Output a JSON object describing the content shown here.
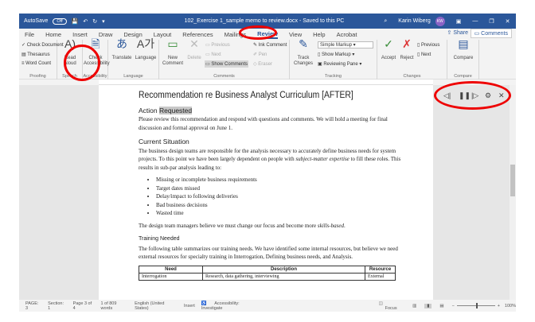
{
  "title": {
    "autosave": "AutoSave",
    "autosave_state": "Off",
    "doc": "102_Exercise 1_sample memo to review.docx  -  Saved to this PC",
    "user": "Karin Wiberg",
    "initials": "KW"
  },
  "tabs": [
    "File",
    "Home",
    "Insert",
    "Draw",
    "Design",
    "Layout",
    "References",
    "Mailings",
    "Review",
    "View",
    "Help",
    "Acrobat"
  ],
  "share": "Share",
  "comments_btn": "Comments",
  "ribbon": {
    "proofing": {
      "label": "Proofing",
      "items": [
        "Check Document",
        "Thesaurus",
        "Word Count"
      ]
    },
    "speech": {
      "label": "Speech",
      "read": "Read",
      "aloud": "Aloud"
    },
    "accessibility": {
      "label": "Accessibility",
      "l1": "Check",
      "l2": "Accessibility"
    },
    "language": {
      "label": "Language",
      "translate": "Translate",
      "language": "Language"
    },
    "comments": {
      "label": "Comments",
      "new1": "New",
      "new2": "Comment",
      "delete": "Delete",
      "previous": "Previous",
      "next": "Next",
      "show": "Show Comments"
    },
    "ink": {
      "ink": "Ink Comment",
      "pen": "Pen",
      "eraser": "Eraser"
    },
    "tracking": {
      "label": "Tracking",
      "track1": "Track",
      "track2": "Changes",
      "markup": "Simple Markup",
      "show_markup": "Show Markup",
      "pane": "Reviewing Pane"
    },
    "changes": {
      "label": "Changes",
      "accept": "Accept",
      "reject": "Reject",
      "previous": "Previous",
      "next": "Next"
    },
    "compare": {
      "label": "Compare",
      "compare": "Compare"
    }
  },
  "doc": {
    "title": "Recommendation re Business Analyst Curriculum [AFTER]",
    "h_action_1": "Action ",
    "h_action_2": "Requested",
    "p1": "Please review this recommendation and respond with questions and comments. We will hold a meeting for final discussion and formal approval on June 1.",
    "h_current": "Current Situation",
    "p2a": "The business design teams are responsible for the analysis necessary to accurately define business needs for system projects. To this point we have been largely dependent on people with ",
    "p2b": "subject-matter expertise",
    "p2c": " to fill these roles. This results in sub-par analysis leading to:",
    "bullets": [
      "Missing or incomplete business requirements",
      "Target dates missed",
      "Delay/impact to following deliveries",
      "Bad business decisions",
      "Wasted time"
    ],
    "p3a": "The design team managers believe we must change our focus and become more ",
    "p3b": "skills-based",
    "p3c": ".",
    "h_training": "Training Needed",
    "p4": "The following table summarizes our training needs. We have identified some internal resources, but believe we need external resources for specialty training in Interrogation, Defining business needs, and Analysis.",
    "table": {
      "headers": [
        "Need",
        "Description",
        "Resource"
      ],
      "row": [
        "Interrogation",
        "Research, data gathering, interviewing",
        "External"
      ]
    }
  },
  "status": {
    "page": "PAGE: 3",
    "section": "Section: 1",
    "pageof": "Page 3 of 4",
    "words": "1 of 809 words",
    "lang": "English (United States)",
    "mode": "Insert",
    "access": "Accessibility: Investigate",
    "focus": "Focus",
    "zoom": "100%"
  },
  "colors": {
    "brand": "#2b579a",
    "highlight": "#e00000"
  }
}
